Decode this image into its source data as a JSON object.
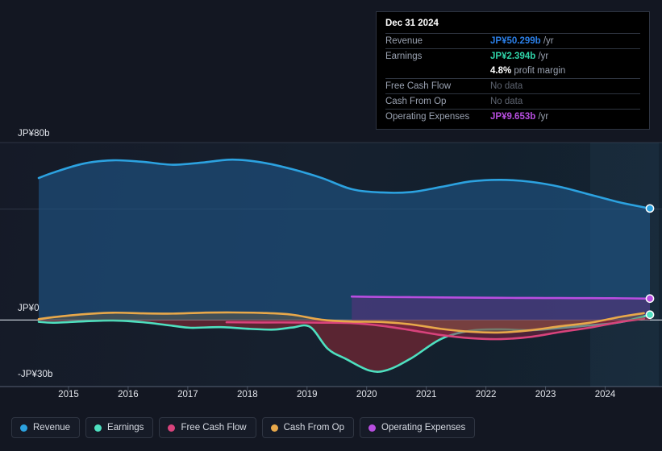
{
  "chart_data": {
    "type": "area",
    "title": "",
    "xlabel": "",
    "ylabel": "",
    "currency_prefix": "JP¥",
    "ylim": [
      -30,
      80
    ],
    "xlim": [
      2014.6,
      2025.15
    ],
    "grid": true,
    "legend_position": "bottom-left",
    "y_ticks": [
      {
        "value": 80,
        "label": "JP¥80b"
      },
      {
        "value": 0,
        "label": "JP¥0"
      },
      {
        "value": -30,
        "label": "-JP¥30b"
      }
    ],
    "x_ticks": [
      "2015",
      "2016",
      "2017",
      "2018",
      "2019",
      "2020",
      "2021",
      "2022",
      "2023",
      "2024"
    ],
    "series": [
      {
        "name": "Revenue",
        "color": "#2ca2e0",
        "fill": "rgba(30,86,135,0.62)",
        "x": [
          2014.75,
          2015.0,
          2015.5,
          2016.0,
          2016.5,
          2017.0,
          2017.5,
          2018.0,
          2018.5,
          2019.0,
          2019.5,
          2020.0,
          2020.5,
          2021.0,
          2021.5,
          2022.0,
          2022.5,
          2023.0,
          2023.5,
          2024.0,
          2024.5,
          2025.0
        ],
        "values": [
          64.0,
          66.5,
          70.5,
          72.0,
          71.3,
          70.0,
          71.0,
          72.3,
          71.0,
          68.0,
          64.0,
          59.0,
          57.5,
          57.7,
          60.0,
          62.5,
          63.2,
          62.3,
          60.0,
          56.5,
          53.0,
          50.299
        ]
      },
      {
        "name": "Earnings",
        "color": "#4ee0c0",
        "fill": "rgba(120,40,52,0.70)",
        "x": [
          2014.75,
          2015.0,
          2015.5,
          2016.0,
          2016.5,
          2017.0,
          2017.3,
          2017.8,
          2018.3,
          2018.7,
          2019.0,
          2019.3,
          2019.6,
          2019.9,
          2020.3,
          2020.6,
          2021.0,
          2021.5,
          2022.0,
          2022.5,
          2023.0,
          2023.5,
          2024.0,
          2024.5,
          2025.0
        ],
        "values": [
          -0.8,
          -1.2,
          -0.6,
          -0.2,
          -1.0,
          -2.6,
          -3.5,
          -3.2,
          -4.0,
          -4.3,
          -3.4,
          -3.1,
          -13.0,
          -17.5,
          -22.8,
          -22.5,
          -17.2,
          -8.5,
          -4.8,
          -4.2,
          -4.6,
          -3.6,
          -2.4,
          -1.0,
          2.394
        ]
      },
      {
        "name": "Free Cash Flow",
        "color": "#d8437c",
        "fill": "rgba(150,38,70,0.45)",
        "x": [
          2017.9,
          2018.5,
          2019.0,
          2019.5,
          2020.0,
          2020.5,
          2021.0,
          2021.5,
          2022.0,
          2022.5,
          2023.0,
          2023.5,
          2024.0,
          2024.5,
          2024.9
        ],
        "values": [
          -1.0,
          -1.1,
          -1.1,
          -1.2,
          -1.4,
          -2.6,
          -4.6,
          -6.8,
          -8.2,
          -8.6,
          -7.6,
          -5.4,
          -3.4,
          -0.9,
          0.6
        ]
      },
      {
        "name": "Cash From Op",
        "color": "#e8a84a",
        "fill": "rgba(120,100,70,0.42)",
        "x": [
          2014.75,
          2015.0,
          2015.5,
          2016.0,
          2016.5,
          2017.0,
          2017.5,
          2018.0,
          2018.5,
          2019.0,
          2019.5,
          2020.0,
          2020.5,
          2021.0,
          2021.5,
          2022.0,
          2022.5,
          2023.0,
          2023.5,
          2024.0,
          2024.5,
          2024.9
        ],
        "values": [
          0.4,
          1.3,
          2.6,
          3.3,
          3.0,
          2.9,
          3.3,
          3.4,
          3.2,
          2.4,
          0.1,
          -0.7,
          -0.9,
          -2.0,
          -4.0,
          -5.3,
          -5.6,
          -4.6,
          -2.8,
          -1.2,
          1.4,
          3.1
        ]
      },
      {
        "name": "Operating Expenses",
        "color": "#b84ee0",
        "fill": "rgba(86,52,122,0.62)",
        "x": [
          2020.0,
          2020.5,
          2021.0,
          2021.5,
          2022.0,
          2022.5,
          2023.0,
          2023.5,
          2024.0,
          2024.5,
          2025.0
        ],
        "values": [
          10.6,
          10.4,
          10.3,
          10.2,
          10.1,
          10.0,
          9.95,
          9.9,
          9.85,
          9.8,
          9.653
        ]
      }
    ],
    "endpoint_markers": [
      {
        "series": "Revenue",
        "x": 2025.0,
        "value": 50.299,
        "color": "#2ca2e0"
      },
      {
        "series": "Operating Expenses",
        "x": 2025.0,
        "value": 9.653,
        "color": "#b84ee0"
      },
      {
        "series": "Earnings",
        "x": 2025.0,
        "value": 2.394,
        "color": "#4ee0c0"
      }
    ],
    "highlight_band": {
      "from": 2024.0,
      "to": 2025.15
    }
  },
  "tooltip": {
    "date": "Dec 31 2024",
    "rows": [
      {
        "key": "Revenue",
        "value": "JP¥50.299b",
        "unit": "/yr",
        "color": "#2b7fe8",
        "no_data": false
      },
      {
        "key": "Earnings",
        "value": "JP¥2.394b",
        "unit": "/yr",
        "color": "#2fd3a8",
        "no_data": false
      },
      {
        "key": "",
        "value": "4.8%",
        "unit": "profit margin",
        "color": "#ffffff",
        "no_data": false,
        "is_margin": true
      },
      {
        "key": "Free Cash Flow",
        "value": "No data",
        "unit": "",
        "color": "#5d636f",
        "no_data": true
      },
      {
        "key": "Cash From Op",
        "value": "No data",
        "unit": "",
        "color": "#5d636f",
        "no_data": true
      },
      {
        "key": "Operating Expenses",
        "value": "JP¥9.653b",
        "unit": "/yr",
        "color": "#b84ee0",
        "no_data": false
      }
    ]
  },
  "legend": {
    "items": [
      {
        "label": "Revenue",
        "color": "#2ca2e0"
      },
      {
        "label": "Earnings",
        "color": "#4ee0c0"
      },
      {
        "label": "Free Cash Flow",
        "color": "#d8437c"
      },
      {
        "label": "Cash From Op",
        "color": "#e8a84a"
      },
      {
        "label": "Operating Expenses",
        "color": "#b84ee0"
      }
    ]
  }
}
